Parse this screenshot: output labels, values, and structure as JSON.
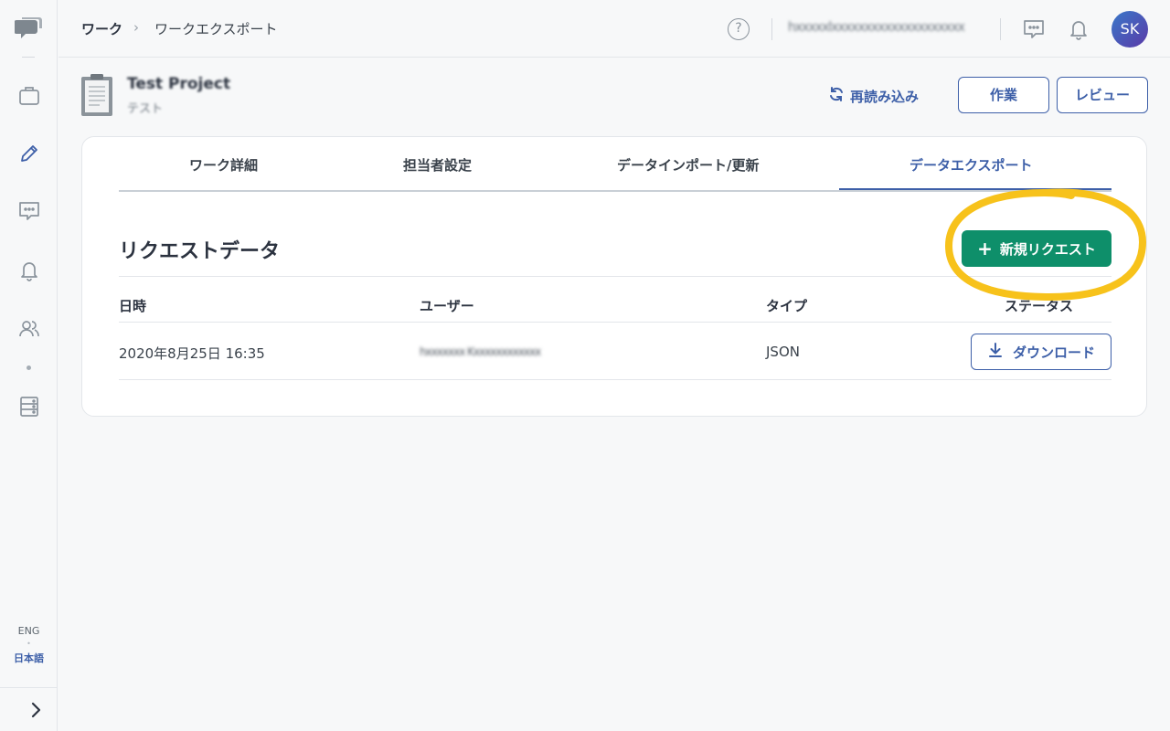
{
  "sidebar": {
    "icons": [
      "logo-icon",
      "briefcase-icon",
      "pencil-icon",
      "chat-icon",
      "bell-icon",
      "users-icon",
      "server-icon"
    ],
    "lang_eng": "ENG",
    "lang_sep": "•",
    "lang_jp": "日本語",
    "expand_glyph": "›"
  },
  "topbar": {
    "breadcrumb_root": "ワーク",
    "breadcrumb_sep": "›",
    "breadcrumb_current": "ワークエクスポート",
    "help_glyph": "?",
    "email": "hxxxxxlxxxxxxxxxxxxxxxxxxxx",
    "avatar_initials": "SK"
  },
  "project": {
    "name": "Test Project",
    "sub": "テスト",
    "reload_label": "再読み込み",
    "work_button": "作業",
    "review_button": "レビュー"
  },
  "tabs": [
    {
      "label": "ワーク詳細"
    },
    {
      "label": "担当者設定"
    },
    {
      "label": "データインポート/更新"
    },
    {
      "label": "データエクスポート"
    }
  ],
  "active_tab": 3,
  "section": {
    "title": "リクエストデータ",
    "new_request_button": "新規リクエスト",
    "plus_glyph": "+"
  },
  "table": {
    "headers": [
      "日時",
      "ユーザー",
      "タイプ",
      "ステータス"
    ],
    "rows": [
      {
        "datetime": "2020年8月25日 16:35",
        "user": "hxxxxxxx Kxxxxxxxxxxxx",
        "type": "JSON",
        "action": "ダウンロード"
      }
    ]
  },
  "colors": {
    "accent": "#3d5fa8",
    "primary_green": "#0e8f6a",
    "highlight": "#f7c21b"
  }
}
